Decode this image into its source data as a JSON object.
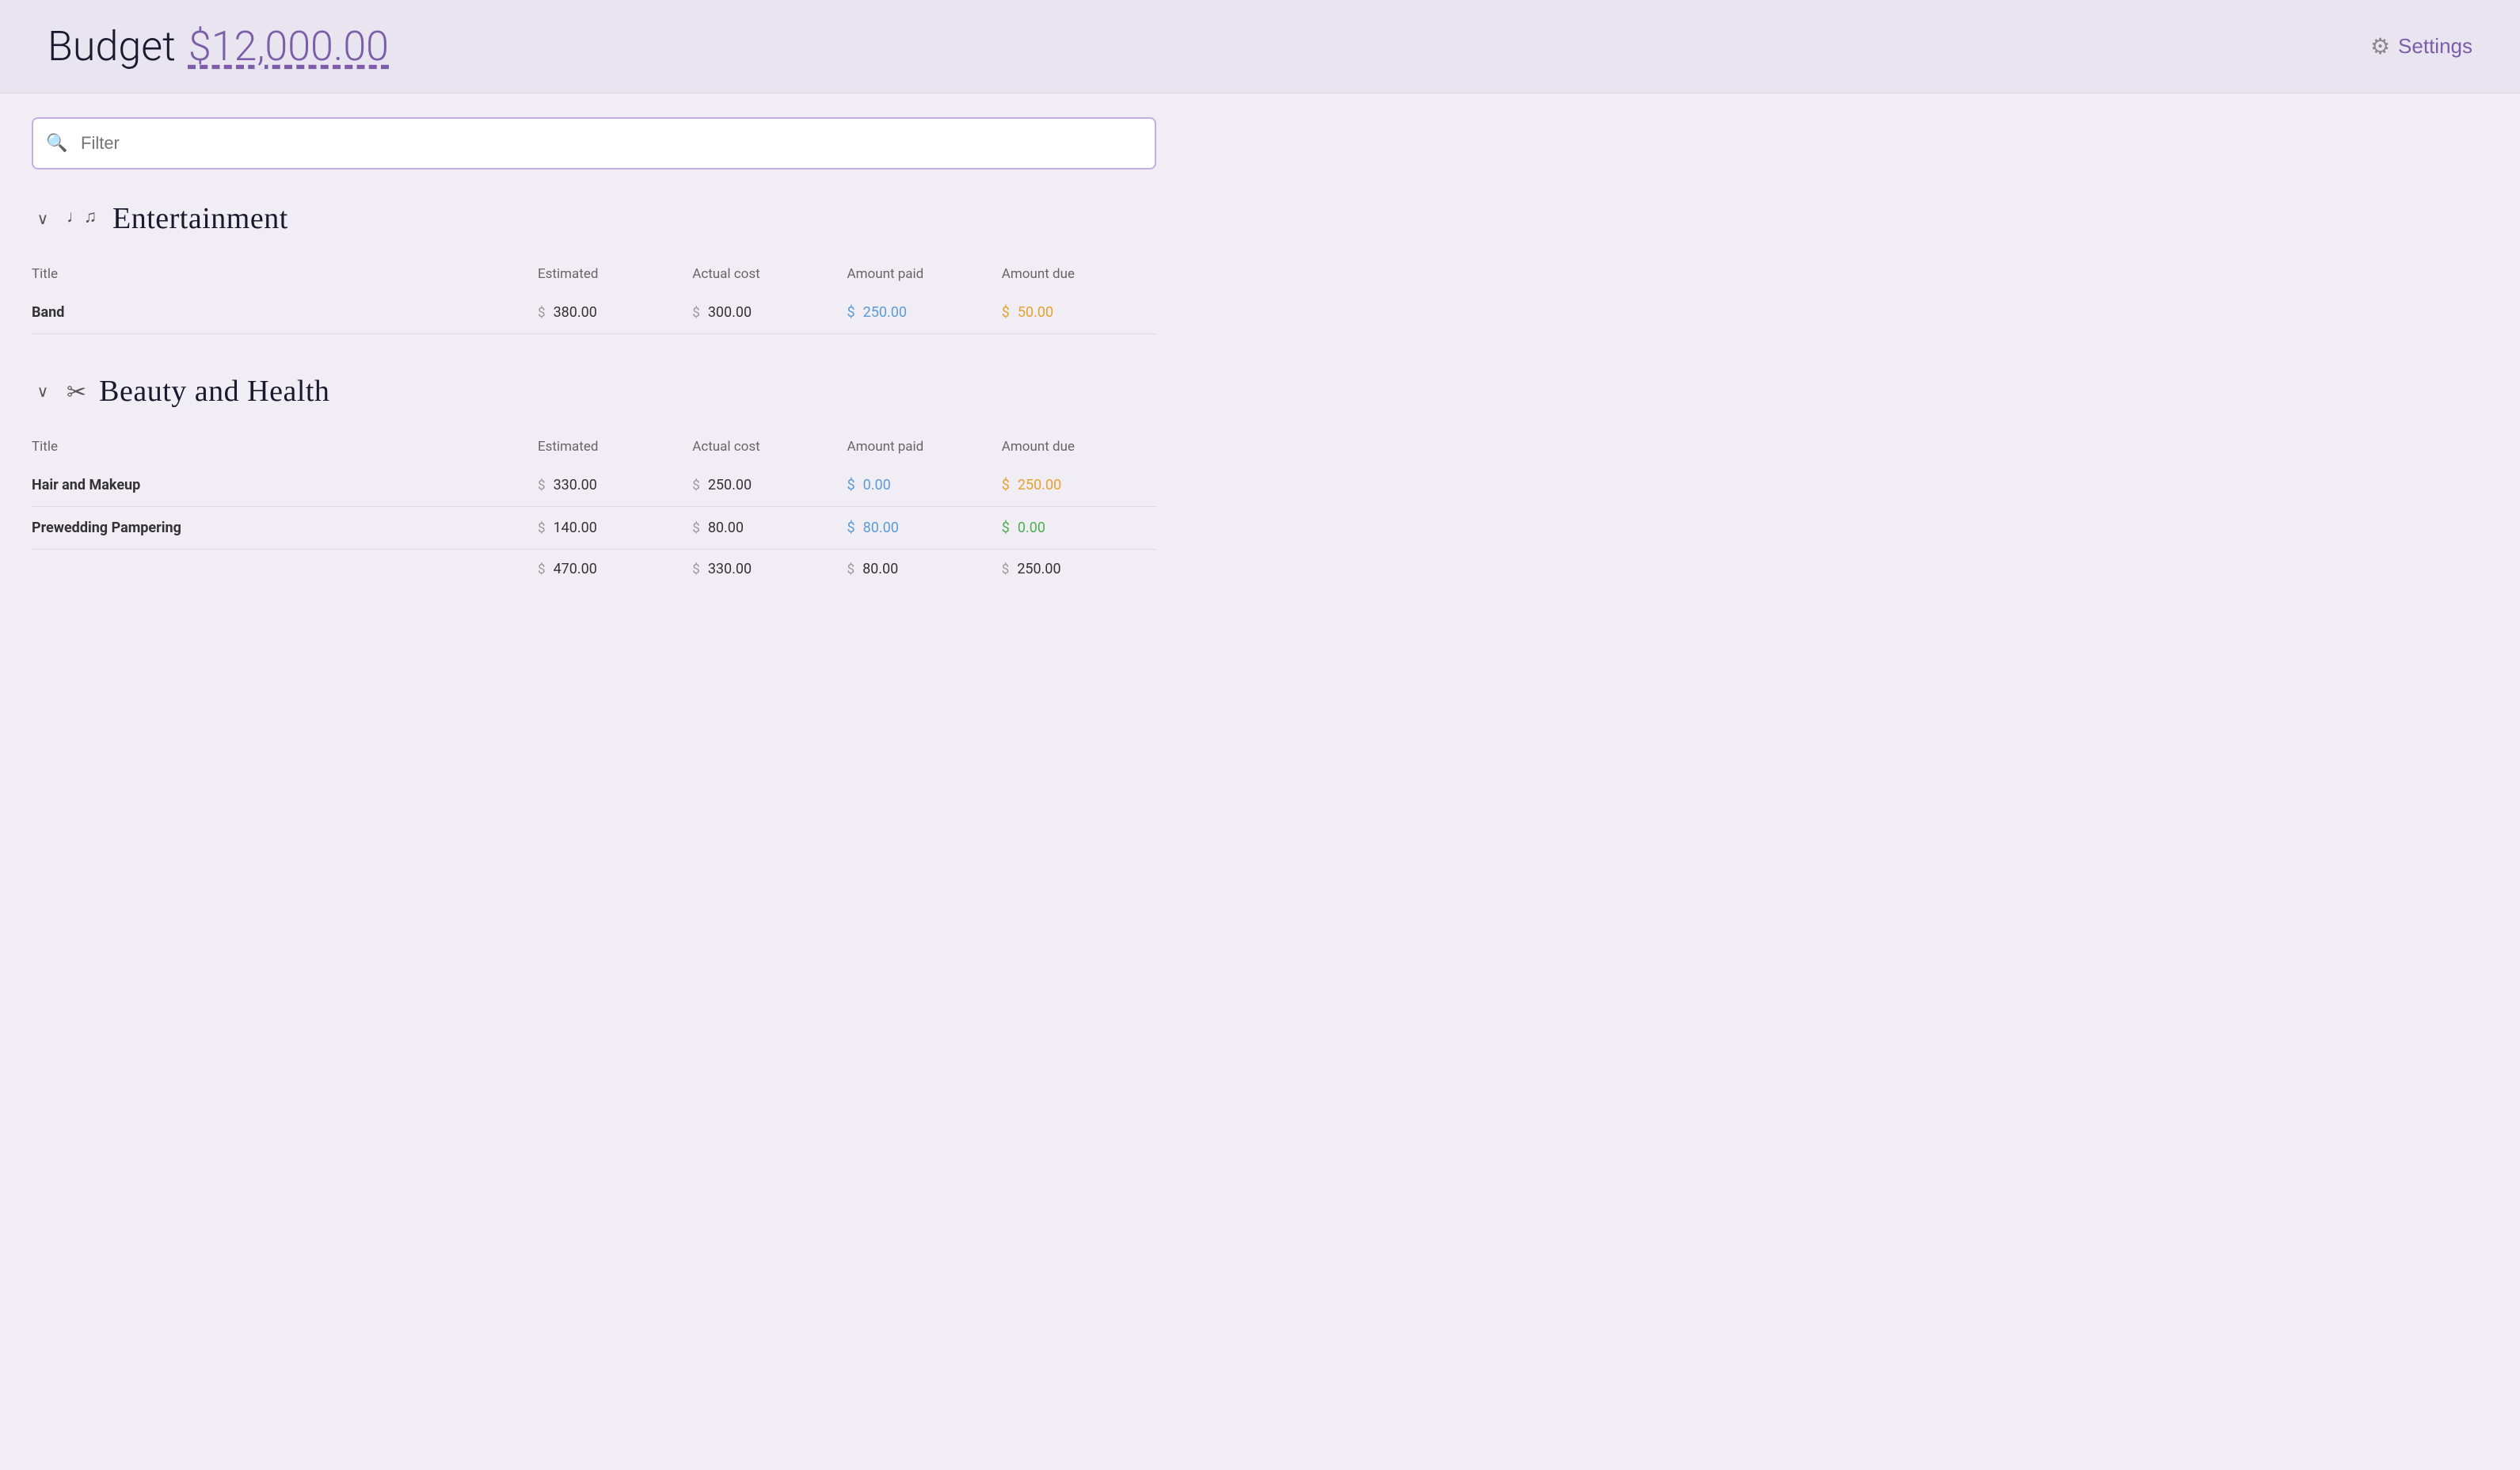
{
  "header": {
    "title": "Budget",
    "budget_amount": "$12,000.00",
    "settings_label": "Settings"
  },
  "filter": {
    "placeholder": "Filter"
  },
  "categories": [
    {
      "id": "entertainment",
      "title": "Entertainment",
      "icon": "music-icon",
      "icon_char": "♫",
      "columns": [
        "Title",
        "Estimated",
        "Actual cost",
        "Amount paid",
        "Amount due"
      ],
      "items": [
        {
          "title": "Band",
          "estimated": "380.00",
          "actual_cost": "300.00",
          "amount_paid": "250.00",
          "amount_due": "50.00",
          "paid_color": "blue",
          "due_color": "orange"
        }
      ],
      "totals": null
    },
    {
      "id": "beauty-and-health",
      "title": "Beauty and Health",
      "icon": "hairdryer-icon",
      "icon_char": "✂",
      "columns": [
        "Title",
        "Estimated",
        "Actual cost",
        "Amount paid",
        "Amount due"
      ],
      "items": [
        {
          "title": "Hair and Makeup",
          "estimated": "330.00",
          "actual_cost": "250.00",
          "amount_paid": "0.00",
          "amount_due": "250.00",
          "paid_color": "blue",
          "due_color": "orange"
        },
        {
          "title": "Prewedding Pampering",
          "estimated": "140.00",
          "actual_cost": "80.00",
          "amount_paid": "80.00",
          "amount_due": "0.00",
          "paid_color": "blue",
          "due_color": "green"
        }
      ],
      "totals": {
        "estimated": "470.00",
        "actual_cost": "330.00",
        "amount_paid": "80.00",
        "amount_due": "250.00"
      }
    }
  ]
}
